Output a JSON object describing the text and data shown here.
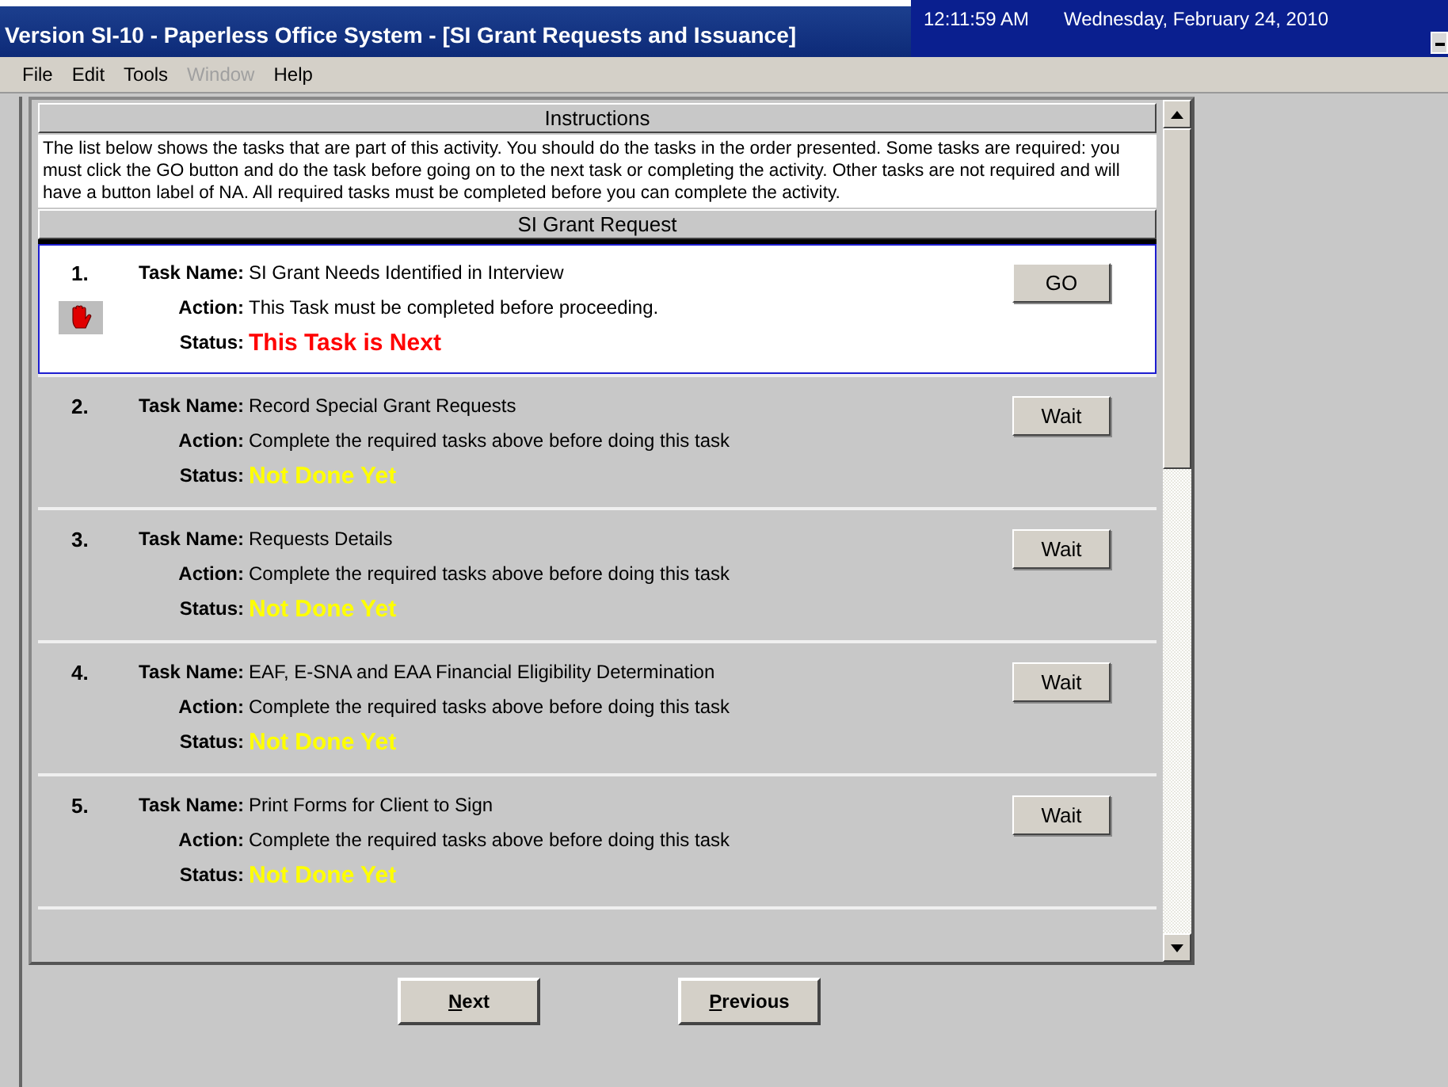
{
  "window": {
    "title": "Version SI-10 - Paperless Office System - [SI Grant Requests and Issuance]",
    "time": "12:11:59 AM",
    "date": "Wednesday, February 24, 2010"
  },
  "menu": [
    {
      "label": "File",
      "disabled": false
    },
    {
      "label": "Edit",
      "disabled": false
    },
    {
      "label": "Tools",
      "disabled": false
    },
    {
      "label": "Window",
      "disabled": true
    },
    {
      "label": "Help",
      "disabled": false
    }
  ],
  "instructions": {
    "heading": "Instructions",
    "text": "The list below shows the tasks that are part of this activity.  You should do the tasks in the order presented.  Some tasks are required: you must click the GO button and do the task before going on to the next task or completing the activity.  Other tasks are not required and will have a button label of NA.  All required tasks must be completed before you can complete the activity."
  },
  "section": {
    "heading": "SI Grant Request"
  },
  "tasks": [
    {
      "number": "1.",
      "name_label": "Task Name:",
      "name": "SI Grant Needs Identified in Interview",
      "action_label": "Action:",
      "action": "This Task must be completed before proceeding.",
      "status_label": "Status:",
      "status": "This Task is Next",
      "color": "#ff0000",
      "stop": true,
      "selected": true,
      "button": "GO"
    },
    {
      "number": "2.",
      "name_label": "Task Name:",
      "name": "Record Special Grant Requests",
      "action_label": "Action:",
      "action": "Complete the required tasks above before doing this task",
      "status_label": "Status:",
      "status": "Not Done Yet",
      "color": "#ffff00",
      "stop": false,
      "selected": false,
      "button": "Wait"
    },
    {
      "number": "3.",
      "name_label": "Task Name:",
      "name": "Requests Details",
      "action_label": "Action:",
      "action": "Complete the required tasks above before doing this task",
      "status_label": "Status:",
      "status": "Not Done Yet",
      "color": "#ffff00",
      "stop": false,
      "selected": false,
      "button": "Wait"
    },
    {
      "number": "4.",
      "name_label": "Task Name:",
      "name": "EAF, E-SNA and EAA Financial Eligibility Determination",
      "action_label": "Action:",
      "action": "Complete the required tasks above before doing this task",
      "status_label": "Status:",
      "status": "Not Done Yet",
      "color": "#ffff00",
      "stop": false,
      "selected": false,
      "button": "Wait"
    },
    {
      "number": "5.",
      "name_label": "Task Name:",
      "name": "Print Forms for Client to Sign",
      "action_label": "Action:",
      "action": "Complete the required tasks above before doing this task",
      "status_label": "Status:",
      "status": "Not Done Yet",
      "color": "#ffff00",
      "stop": false,
      "selected": false,
      "button": "Wait"
    }
  ],
  "buttons": [
    {
      "label": "Next"
    },
    {
      "label": "Previous"
    }
  ]
}
